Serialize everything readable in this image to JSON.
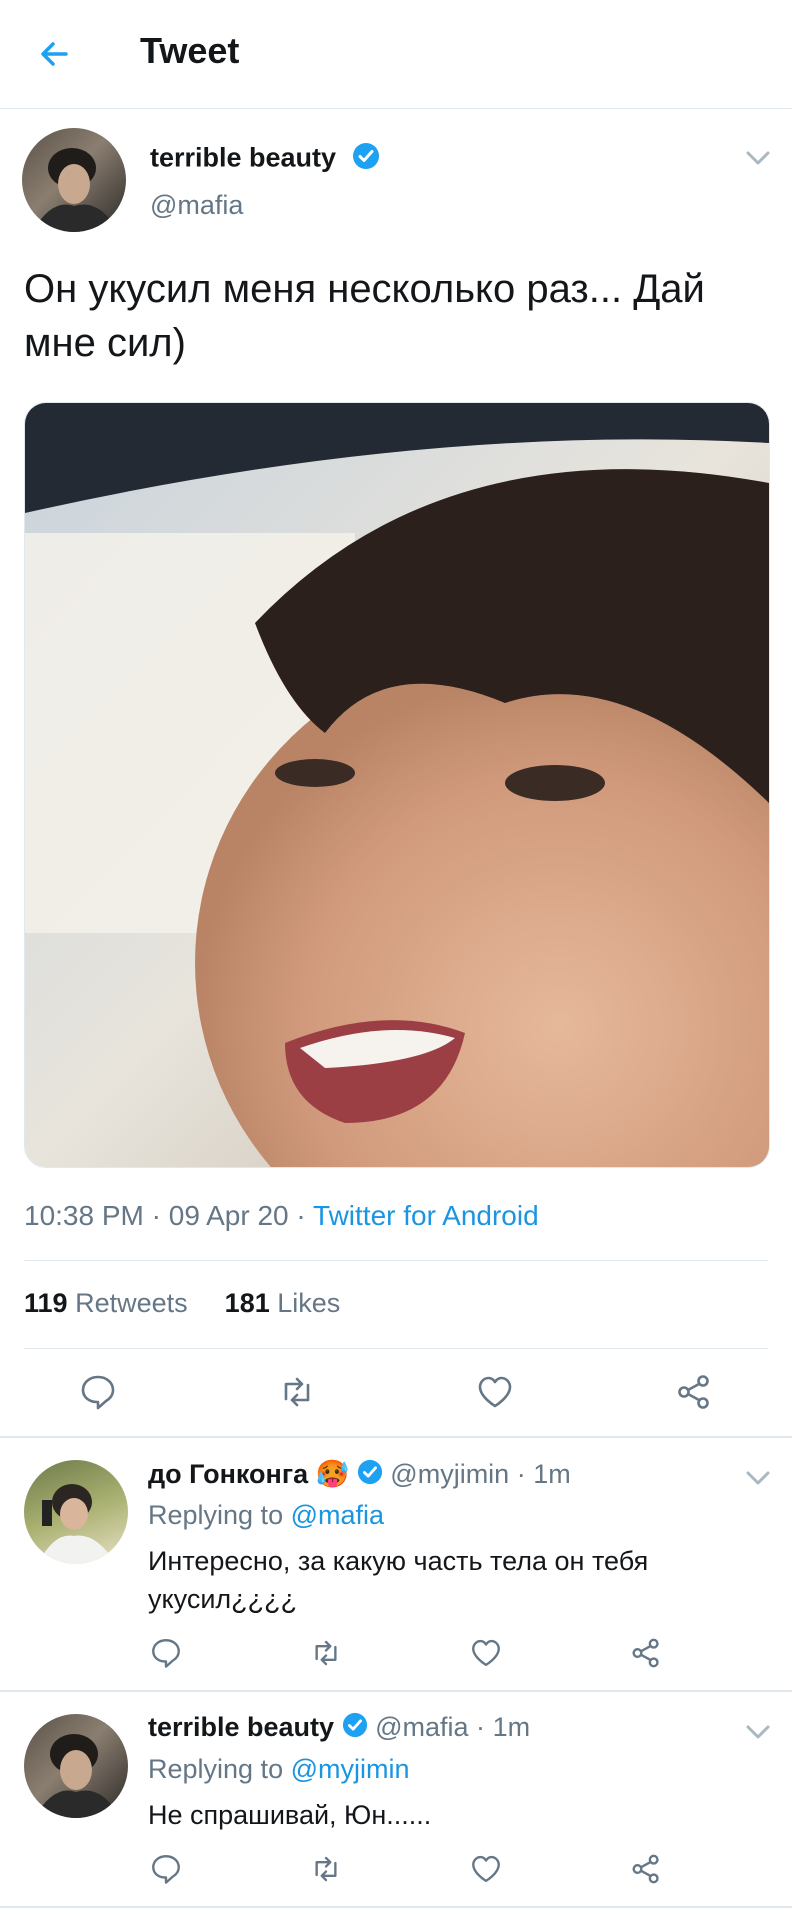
{
  "header": {
    "title": "Tweet"
  },
  "main_tweet": {
    "display_name": "terrible beauty",
    "handle": "@mafia",
    "text": "Он укусил меня несколько раз... Дай мне сил)",
    "time": "10:38 PM",
    "date": "09 Apr 20",
    "sep1": "·",
    "sep2": "·",
    "source": "Twitter for Android",
    "retweets_count": "119",
    "retweets_label": "Retweets",
    "likes_count": "181",
    "likes_label": "Likes"
  },
  "replies": [
    {
      "display_name": "до Гонконга",
      "emoji": "🥵",
      "handle": "@myjimin",
      "sep": "·",
      "time": "1m",
      "replying_label": "Replying to",
      "replying_to": "@mafia",
      "text": "Интересно, за какую часть тела он тебя укусил¿¿¿¿"
    },
    {
      "display_name": "terrible beauty",
      "handle": "@mafia",
      "sep": "·",
      "time": "1m",
      "replying_label": "Replying to",
      "replying_to": "@myjimin",
      "text": "Не спрашивай, Юн......"
    }
  ],
  "colors": {
    "accent": "#1da1f2",
    "link": "#1b95e0",
    "muted": "#657786",
    "divider": "#e1e8ed"
  },
  "icons": [
    "back-arrow-icon",
    "verified-badge-icon",
    "chevron-down-icon",
    "reply-icon",
    "retweet-icon",
    "like-icon",
    "share-icon"
  ]
}
